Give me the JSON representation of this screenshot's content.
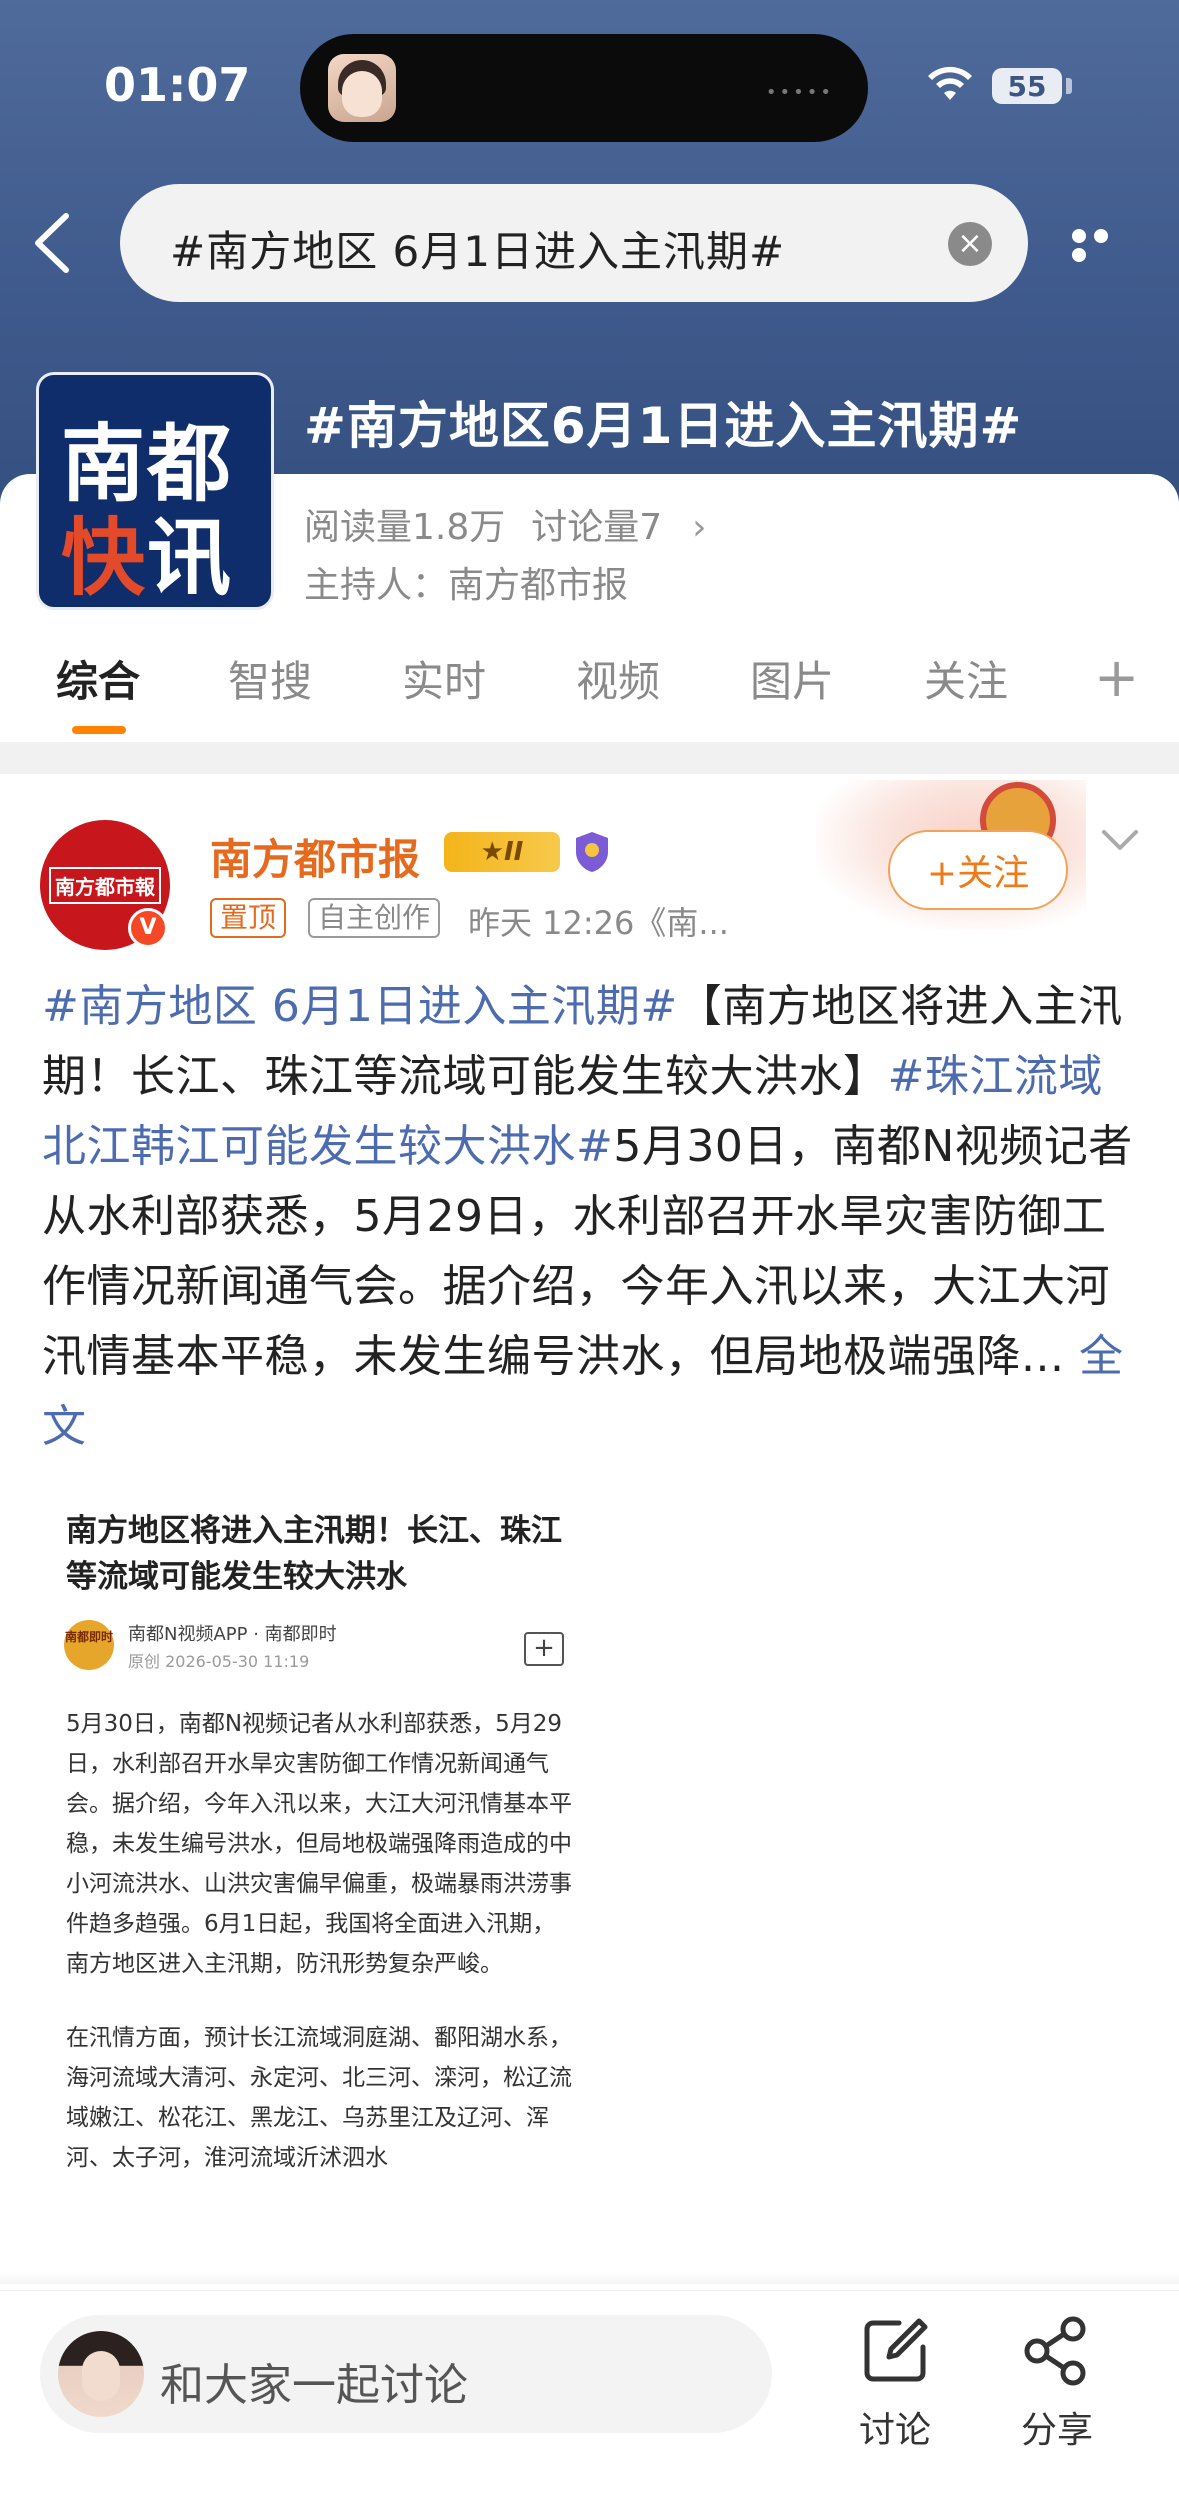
{
  "status_bar": {
    "time": "01:07",
    "battery": "55"
  },
  "search": {
    "query": "#南方地区 6月1日进入主汛期#"
  },
  "topic": {
    "logo_line1": "南都",
    "logo_line2a": "快",
    "logo_line2b": "讯",
    "title": "#南方地区6月1日进入主汛期#",
    "reads": "阅读量1.8万",
    "discussions": "讨论量7",
    "host": "主持人：南方都市报"
  },
  "tabs": [
    {
      "label": "综合"
    },
    {
      "label": "智搜"
    },
    {
      "label": "实时"
    },
    {
      "label": "视频"
    },
    {
      "label": "图片"
    },
    {
      "label": "关注"
    }
  ],
  "post": {
    "avatar_text": "南方都市報",
    "verified_mark": "V",
    "user": "南方都市报",
    "level_badge": "II",
    "tag_pinned": "置顶",
    "tag_original": "自主创作",
    "meta": "昨天 12:26《南...",
    "follow_label": "+关注",
    "body": {
      "link1": "#南方地区 6月1日进入主汛期#",
      "text1": "【南方地区将进入主汛期！长江、珠江等流域可能发生较大洪水】",
      "link2": "#珠江流域北江韩江可能发生较大洪水#",
      "text2": "5月30日，南都N视频记者从水利部获悉，5月29日，水利部召开水旱灾害防御工作情况新闻通气会。据介绍，今年入汛以来，大江大河汛情基本平稳，未发生编号洪水，但局地极端强降...",
      "expand": "全文"
    }
  },
  "article": {
    "title": "南方地区将进入主汛期！长江、珠江等流域可能发生较大洪水",
    "logo_text": "南都即时",
    "source": "南都N视频APP · 南都即时",
    "date": "原创  2026-05-30 11:19",
    "plus": "+",
    "para1": "5月30日，南都N视频记者从水利部获悉，5月29日，水利部召开水旱灾害防御工作情况新闻通气会。据介绍，今年入汛以来，大江大河汛情基本平稳，未发生编号洪水，但局地极端强降雨造成的中小河流洪水、山洪灾害偏早偏重，极端暴雨洪涝事件趋多趋强。6月1日起，我国将全面进入汛期，南方地区进入主汛期，防汛形势复杂严峻。",
    "para2": "在汛情方面，预计长江流域洞庭湖、鄱阳湖水系，海河流域大清河、永定河、北三河、滦河，松辽流域嫩江、松花江、黑龙江、乌苏里江及辽河、浑河、太子河，淮河流域沂沭泗水"
  },
  "bottom": {
    "comment_placeholder": "和大家一起讨论",
    "discuss_label": "讨论",
    "share_label": "分享"
  },
  "colors": {
    "header_blue": "#3f5a8c",
    "accent_orange": "#ff8200",
    "link_blue": "#4d6cb0",
    "username_orange": "#e66a1d"
  }
}
